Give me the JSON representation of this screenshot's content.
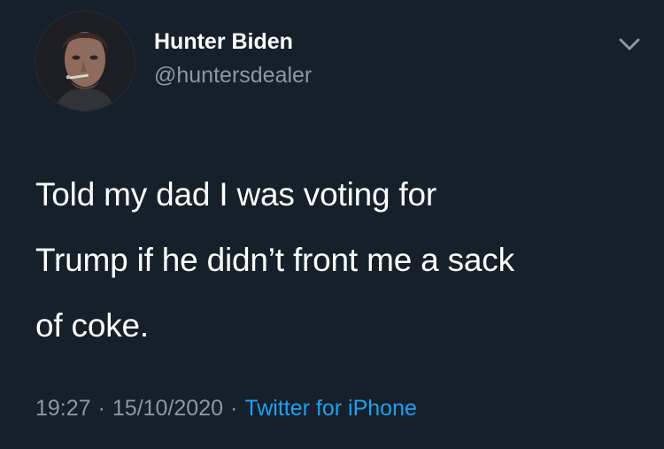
{
  "user": {
    "display_name": "Hunter Biden",
    "handle": "@huntersdealer"
  },
  "tweet": {
    "text_lines": [
      "Told my dad I was voting for",
      "Trump if he didn’t front me a sack",
      "of coke."
    ],
    "time": "19:27",
    "date": "15/10/2020",
    "separator": "·",
    "source": "Twitter for iPhone"
  },
  "icons": {
    "menu": "chevron-down-icon",
    "avatar": "profile-photo"
  },
  "colors": {
    "background": "#15202b",
    "text": "#ffffff",
    "secondary": "#8899a6",
    "link": "#1da1f2"
  }
}
